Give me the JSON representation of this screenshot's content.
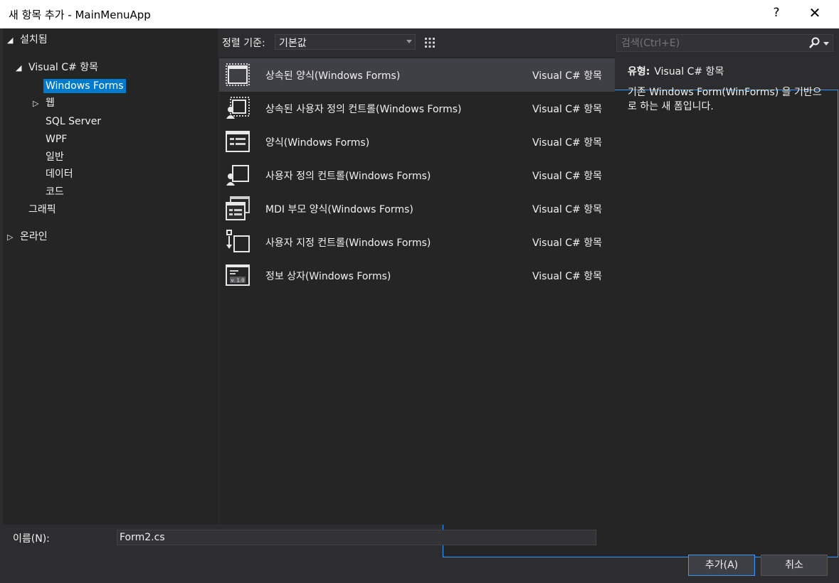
{
  "window": {
    "title": "새 항목 추가 - MainMenuApp",
    "help": "?",
    "close": "✕"
  },
  "tree": {
    "installed": "설치됨",
    "visual_cs": "Visual C# 항목",
    "children": [
      "Windows Forms",
      "웹",
      "SQL Server",
      "WPF",
      "일반",
      "데이터",
      "코드"
    ],
    "graphics": "그래픽",
    "online": "온라인"
  },
  "sort": {
    "label": "정렬 기준:",
    "value": "기본값"
  },
  "templates": [
    {
      "name": "상속된 양식(Windows Forms)",
      "category": "Visual C# 항목",
      "icon": "inherited-form-icon"
    },
    {
      "name": "상속된 사용자 정의 컨트롤(Windows Forms)",
      "category": "Visual C# 항목",
      "icon": "inherited-usercontrol-icon"
    },
    {
      "name": "양식(Windows Forms)",
      "category": "Visual C# 항목",
      "icon": "form-icon"
    },
    {
      "name": "사용자 정의 컨트롤(Windows Forms)",
      "category": "Visual C# 항목",
      "icon": "usercontrol-icon"
    },
    {
      "name": "MDI 부모 양식(Windows Forms)",
      "category": "Visual C# 항목",
      "icon": "mdi-form-icon"
    },
    {
      "name": "사용자 지정 컨트롤(Windows Forms)",
      "category": "Visual C# 항목",
      "icon": "custom-control-icon"
    },
    {
      "name": "정보 상자(Windows Forms)",
      "category": "Visual C# 항목",
      "icon": "about-box-icon"
    }
  ],
  "search": {
    "placeholder": "검색(Ctrl+E)"
  },
  "details": {
    "type_label": "유형:",
    "type_value": "Visual C# 항목",
    "description": "기존 Windows Form(WinForms) 을 기반으로 하는 새 폼입니다."
  },
  "name_field": {
    "label": "이름(N):",
    "value": "Form2.cs"
  },
  "buttons": {
    "add": "추가(A)",
    "cancel": "취소"
  },
  "about_icon_text": "v. 1.0"
}
